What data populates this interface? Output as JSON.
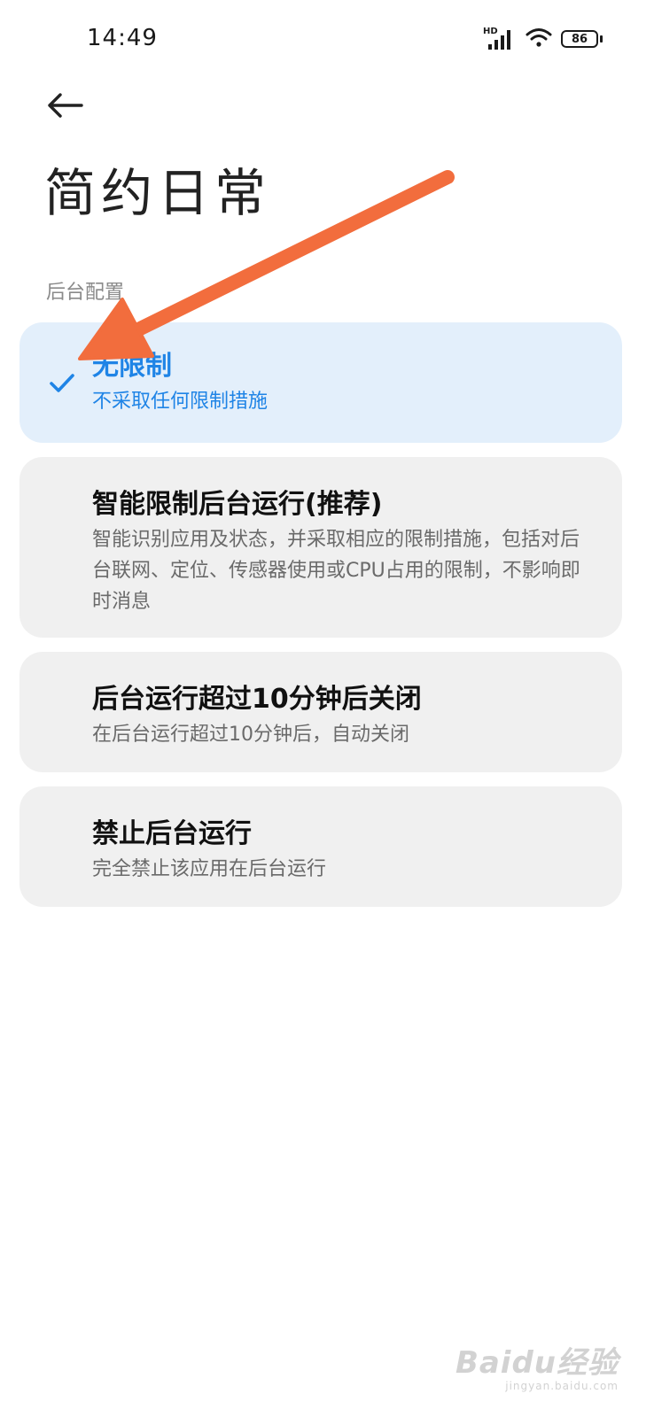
{
  "status_bar": {
    "time": "14:49",
    "network_label": "HD",
    "battery": "86"
  },
  "header": {
    "title": "简约日常"
  },
  "section": {
    "label": "后台配置"
  },
  "options": [
    {
      "title": "无限制",
      "description": "不采取任何限制措施",
      "selected": true
    },
    {
      "title": "智能限制后台运行(推荐)",
      "description": "智能识别应用及状态，并采取相应的限制措施，包括对后台联网、定位、传感器使用或CPU占用的限制，不影响即时消息",
      "selected": false
    },
    {
      "title": "后台运行超过10分钟后关闭",
      "description": "在后台运行超过10分钟后，自动关闭",
      "selected": false
    },
    {
      "title": "禁止后台运行",
      "description": "完全禁止该应用在后台运行",
      "selected": false
    }
  ],
  "colors": {
    "accent": "#1f84e6",
    "selected_bg": "#e3effb",
    "card_bg": "#f0f0f0",
    "annotation": "#f26d3d"
  },
  "icons": {
    "back": "arrow-left-icon",
    "check": "checkmark-icon",
    "signal": "cellular-signal-icon",
    "wifi": "wifi-icon",
    "battery": "battery-icon"
  },
  "watermark": {
    "logo": "Baidu经验",
    "url": "jingyan.baidu.com"
  }
}
